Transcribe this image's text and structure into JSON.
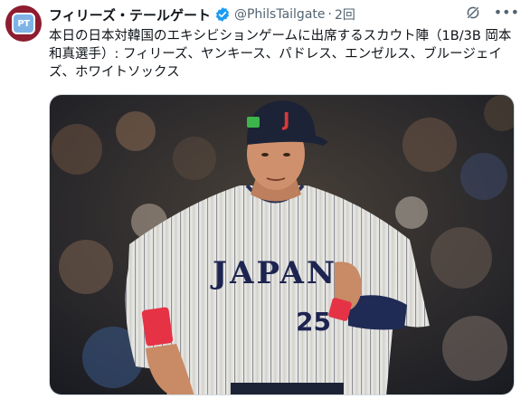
{
  "account": {
    "avatar_text": "PT",
    "display_name": "フィリーズ・テールゲート",
    "verified": true,
    "handle": "@PhilsTailgate",
    "separator": "·",
    "time": "2回"
  },
  "tweet": {
    "text": "本日の日本対韓国のエキシビションゲームに出席するスカウト陣（1B/3B 岡本和真選手）: フィリーズ、ヤンキース、パドレス、エンゼルス、ブルージェイズ、ホワイトソックス"
  },
  "photo": {
    "helmet_letter": "J",
    "jersey_text": "JAPAN",
    "jersey_number": "25"
  },
  "icons": {
    "verified": "verified-badge-icon",
    "grok": "grok-icon",
    "more": "more-icon"
  },
  "colors": {
    "avatar_bg": "#8d1d2f",
    "verified": "#1d9bf0",
    "secondary_text": "#536471"
  }
}
